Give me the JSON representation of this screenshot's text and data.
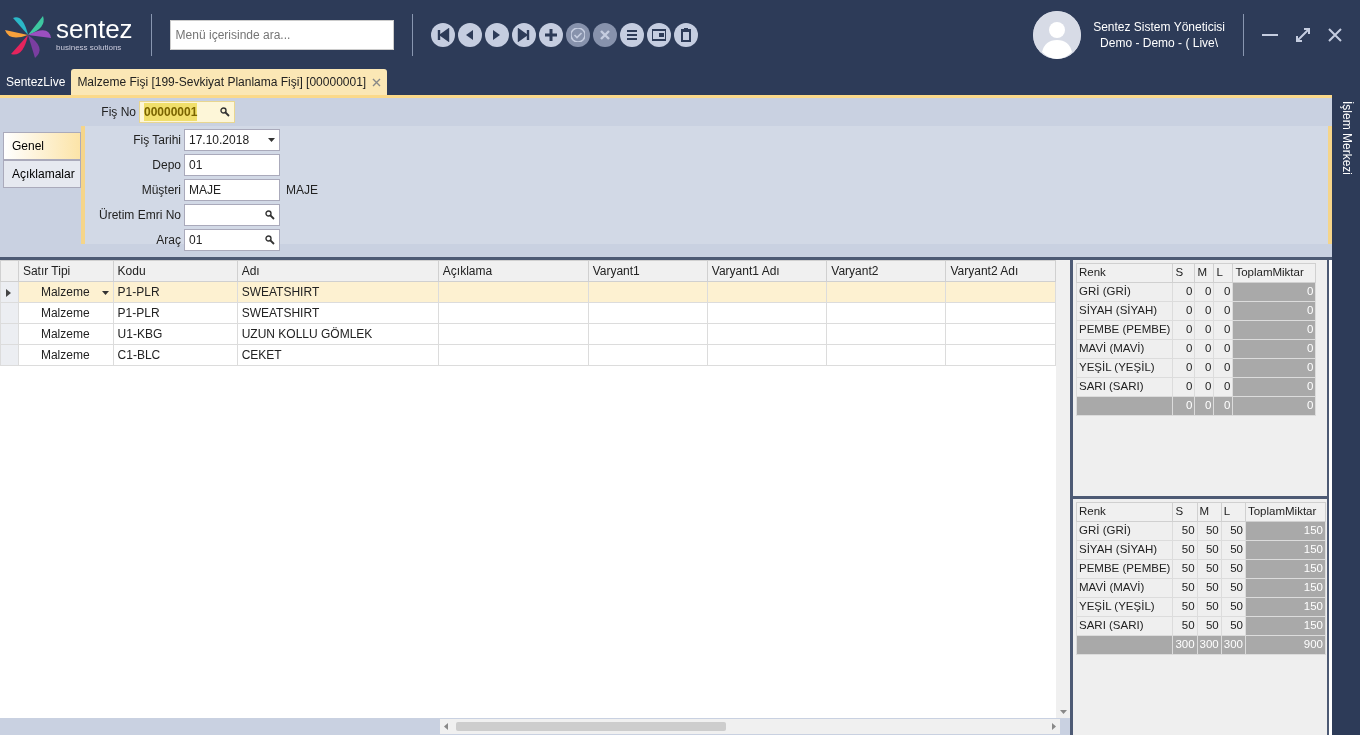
{
  "header": {
    "logo": {
      "name": "sentez",
      "tagline": "business solutions"
    },
    "search": {
      "placeholder": "Menü içerisinde ara..."
    },
    "toolbar": [
      {
        "kind": "first",
        "disabled": false
      },
      {
        "kind": "prev",
        "disabled": false
      },
      {
        "kind": "next",
        "disabled": false
      },
      {
        "kind": "last",
        "disabled": false
      },
      {
        "kind": "add",
        "disabled": false
      },
      {
        "kind": "confirm",
        "disabled": true
      },
      {
        "kind": "cancel",
        "disabled": true
      },
      {
        "kind": "list",
        "disabled": false
      },
      {
        "kind": "card",
        "disabled": false
      },
      {
        "kind": "delete",
        "disabled": false
      }
    ],
    "user": {
      "name": "Sentez Sistem Yöneticisi",
      "context": "Demo - Demo - ( Live\\"
    }
  },
  "doc_tabs": [
    {
      "label": "SentezLive",
      "selected": false,
      "closable": false
    },
    {
      "label": "Malzeme Fişi [199-Sevkiyat Planlama Fişi]  [00000001]",
      "selected": true,
      "closable": true
    }
  ],
  "side_panel": {
    "title": "İşlem Merkezi"
  },
  "form": {
    "fis_no": {
      "label": "Fiş No",
      "value": "00000001"
    },
    "tabs": [
      {
        "label": "Genel",
        "selected": true
      },
      {
        "label": "Açıklamalar",
        "selected": false
      }
    ],
    "fields": [
      {
        "label": "Fiş Tarihi",
        "value": "17.10.2018",
        "kind": "date"
      },
      {
        "label": "Depo",
        "value": "01",
        "kind": "text"
      },
      {
        "label": "Müşteri",
        "value": "MAJE",
        "kind": "text",
        "note": "MAJE"
      },
      {
        "label": "Üretim Emri No",
        "kind": "lookup"
      },
      {
        "label": "Araç",
        "value": "01",
        "kind": "lookup"
      }
    ]
  },
  "grid": {
    "columns": [
      "Satır Tipi",
      "Kodu",
      "Adı",
      "Açıklama",
      "Varyant1",
      "Varyant1 Adı",
      "Varyant2",
      "Varyant2 Adı"
    ],
    "rows": [
      {
        "selected": true,
        "cells": [
          "Malzeme",
          "P1-PLR",
          "SWEATSHIRT",
          "",
          "",
          "",
          "",
          ""
        ]
      },
      {
        "selected": false,
        "cells": [
          "Malzeme",
          "P1-PLR",
          "SWEATSHIRT",
          "",
          "",
          "",
          "",
          ""
        ]
      },
      {
        "selected": false,
        "cells": [
          "Malzeme",
          "U1-KBG",
          "UZUN KOLLU GÖMLEK",
          "",
          "",
          "",
          "",
          ""
        ]
      },
      {
        "selected": false,
        "cells": [
          "Malzeme",
          "C1-BLC",
          "CEKET",
          "",
          "",
          "",
          "",
          ""
        ]
      }
    ]
  },
  "variant_tables": [
    {
      "columns": [
        "Renk",
        "S",
        "M",
        "L",
        "ToplamMiktar"
      ],
      "rows": [
        [
          "GRİ (GRİ)",
          "0",
          "0",
          "0",
          "0"
        ],
        [
          "SİYAH (SİYAH)",
          "0",
          "0",
          "0",
          "0"
        ],
        [
          "PEMBE (PEMBE)",
          "0",
          "0",
          "0",
          "0"
        ],
        [
          "MAVİ (MAVİ)",
          "0",
          "0",
          "0",
          "0"
        ],
        [
          "YEŞİL (YEŞİL)",
          "0",
          "0",
          "0",
          "0"
        ],
        [
          "SARI (SARI)",
          "0",
          "0",
          "0",
          "0"
        ]
      ],
      "totals": [
        "0",
        "0",
        "0",
        "0"
      ]
    },
    {
      "columns": [
        "Renk",
        "S",
        "M",
        "L",
        "ToplamMiktar"
      ],
      "rows": [
        [
          "GRİ (GRİ)",
          "50",
          "50",
          "50",
          "150"
        ],
        [
          "SİYAH (SİYAH)",
          "50",
          "50",
          "50",
          "150"
        ],
        [
          "PEMBE (PEMBE)",
          "50",
          "50",
          "50",
          "150"
        ],
        [
          "MAVİ (MAVİ)",
          "50",
          "50",
          "50",
          "150"
        ],
        [
          "YEŞİL (YEŞİL)",
          "50",
          "50",
          "50",
          "150"
        ],
        [
          "SARI (SARI)",
          "50",
          "50",
          "50",
          "150"
        ]
      ],
      "totals": [
        "300",
        "300",
        "300",
        "900"
      ]
    }
  ]
}
